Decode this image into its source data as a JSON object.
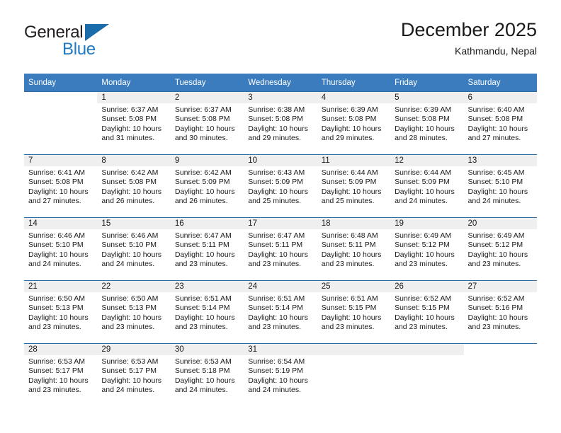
{
  "brand": {
    "name_top": "General",
    "name_bottom": "Blue",
    "color_dark": "#231f20",
    "color_blue": "#1f7ac4",
    "triangle_color": "#1b6cab"
  },
  "header": {
    "title": "December 2025",
    "subtitle": "Kathmandu, Nepal"
  },
  "theme": {
    "header_blue": "#3a7cbe",
    "rule_blue": "#2e6da4",
    "day_band_gray": "#efefef",
    "text": "#1a1a1a"
  },
  "calendar": {
    "weekday_headers": [
      "Sunday",
      "Monday",
      "Tuesday",
      "Wednesday",
      "Thursday",
      "Friday",
      "Saturday"
    ],
    "labels": {
      "sunrise": "Sunrise:",
      "sunset": "Sunset:",
      "daylight": "Daylight:"
    },
    "weeks": [
      [
        {
          "day": "",
          "sunrise": "",
          "sunset": "",
          "daylight": "",
          "band": false
        },
        {
          "day": "1",
          "sunrise": "Sunrise: 6:37 AM",
          "sunset": "Sunset: 5:08 PM",
          "daylight": "Daylight: 10 hours and 31 minutes.",
          "band": true
        },
        {
          "day": "2",
          "sunrise": "Sunrise: 6:37 AM",
          "sunset": "Sunset: 5:08 PM",
          "daylight": "Daylight: 10 hours and 30 minutes.",
          "band": true
        },
        {
          "day": "3",
          "sunrise": "Sunrise: 6:38 AM",
          "sunset": "Sunset: 5:08 PM",
          "daylight": "Daylight: 10 hours and 29 minutes.",
          "band": true
        },
        {
          "day": "4",
          "sunrise": "Sunrise: 6:39 AM",
          "sunset": "Sunset: 5:08 PM",
          "daylight": "Daylight: 10 hours and 29 minutes.",
          "band": true
        },
        {
          "day": "5",
          "sunrise": "Sunrise: 6:39 AM",
          "sunset": "Sunset: 5:08 PM",
          "daylight": "Daylight: 10 hours and 28 minutes.",
          "band": true
        },
        {
          "day": "6",
          "sunrise": "Sunrise: 6:40 AM",
          "sunset": "Sunset: 5:08 PM",
          "daylight": "Daylight: 10 hours and 27 minutes.",
          "band": true
        }
      ],
      [
        {
          "day": "7",
          "sunrise": "Sunrise: 6:41 AM",
          "sunset": "Sunset: 5:08 PM",
          "daylight": "Daylight: 10 hours and 27 minutes.",
          "band": true
        },
        {
          "day": "8",
          "sunrise": "Sunrise: 6:42 AM",
          "sunset": "Sunset: 5:08 PM",
          "daylight": "Daylight: 10 hours and 26 minutes.",
          "band": true
        },
        {
          "day": "9",
          "sunrise": "Sunrise: 6:42 AM",
          "sunset": "Sunset: 5:09 PM",
          "daylight": "Daylight: 10 hours and 26 minutes.",
          "band": true
        },
        {
          "day": "10",
          "sunrise": "Sunrise: 6:43 AM",
          "sunset": "Sunset: 5:09 PM",
          "daylight": "Daylight: 10 hours and 25 minutes.",
          "band": true
        },
        {
          "day": "11",
          "sunrise": "Sunrise: 6:44 AM",
          "sunset": "Sunset: 5:09 PM",
          "daylight": "Daylight: 10 hours and 25 minutes.",
          "band": true
        },
        {
          "day": "12",
          "sunrise": "Sunrise: 6:44 AM",
          "sunset": "Sunset: 5:09 PM",
          "daylight": "Daylight: 10 hours and 24 minutes.",
          "band": true
        },
        {
          "day": "13",
          "sunrise": "Sunrise: 6:45 AM",
          "sunset": "Sunset: 5:10 PM",
          "daylight": "Daylight: 10 hours and 24 minutes.",
          "band": true
        }
      ],
      [
        {
          "day": "14",
          "sunrise": "Sunrise: 6:46 AM",
          "sunset": "Sunset: 5:10 PM",
          "daylight": "Daylight: 10 hours and 24 minutes.",
          "band": true
        },
        {
          "day": "15",
          "sunrise": "Sunrise: 6:46 AM",
          "sunset": "Sunset: 5:10 PM",
          "daylight": "Daylight: 10 hours and 24 minutes.",
          "band": true
        },
        {
          "day": "16",
          "sunrise": "Sunrise: 6:47 AM",
          "sunset": "Sunset: 5:11 PM",
          "daylight": "Daylight: 10 hours and 23 minutes.",
          "band": true
        },
        {
          "day": "17",
          "sunrise": "Sunrise: 6:47 AM",
          "sunset": "Sunset: 5:11 PM",
          "daylight": "Daylight: 10 hours and 23 minutes.",
          "band": true
        },
        {
          "day": "18",
          "sunrise": "Sunrise: 6:48 AM",
          "sunset": "Sunset: 5:11 PM",
          "daylight": "Daylight: 10 hours and 23 minutes.",
          "band": true
        },
        {
          "day": "19",
          "sunrise": "Sunrise: 6:49 AM",
          "sunset": "Sunset: 5:12 PM",
          "daylight": "Daylight: 10 hours and 23 minutes.",
          "band": true
        },
        {
          "day": "20",
          "sunrise": "Sunrise: 6:49 AM",
          "sunset": "Sunset: 5:12 PM",
          "daylight": "Daylight: 10 hours and 23 minutes.",
          "band": true
        }
      ],
      [
        {
          "day": "21",
          "sunrise": "Sunrise: 6:50 AM",
          "sunset": "Sunset: 5:13 PM",
          "daylight": "Daylight: 10 hours and 23 minutes.",
          "band": true
        },
        {
          "day": "22",
          "sunrise": "Sunrise: 6:50 AM",
          "sunset": "Sunset: 5:13 PM",
          "daylight": "Daylight: 10 hours and 23 minutes.",
          "band": true
        },
        {
          "day": "23",
          "sunrise": "Sunrise: 6:51 AM",
          "sunset": "Sunset: 5:14 PM",
          "daylight": "Daylight: 10 hours and 23 minutes.",
          "band": true
        },
        {
          "day": "24",
          "sunrise": "Sunrise: 6:51 AM",
          "sunset": "Sunset: 5:14 PM",
          "daylight": "Daylight: 10 hours and 23 minutes.",
          "band": true
        },
        {
          "day": "25",
          "sunrise": "Sunrise: 6:51 AM",
          "sunset": "Sunset: 5:15 PM",
          "daylight": "Daylight: 10 hours and 23 minutes.",
          "band": true
        },
        {
          "day": "26",
          "sunrise": "Sunrise: 6:52 AM",
          "sunset": "Sunset: 5:15 PM",
          "daylight": "Daylight: 10 hours and 23 minutes.",
          "band": true
        },
        {
          "day": "27",
          "sunrise": "Sunrise: 6:52 AM",
          "sunset": "Sunset: 5:16 PM",
          "daylight": "Daylight: 10 hours and 23 minutes.",
          "band": true
        }
      ],
      [
        {
          "day": "28",
          "sunrise": "Sunrise: 6:53 AM",
          "sunset": "Sunset: 5:17 PM",
          "daylight": "Daylight: 10 hours and 23 minutes.",
          "band": true
        },
        {
          "day": "29",
          "sunrise": "Sunrise: 6:53 AM",
          "sunset": "Sunset: 5:17 PM",
          "daylight": "Daylight: 10 hours and 24 minutes.",
          "band": true
        },
        {
          "day": "30",
          "sunrise": "Sunrise: 6:53 AM",
          "sunset": "Sunset: 5:18 PM",
          "daylight": "Daylight: 10 hours and 24 minutes.",
          "band": true
        },
        {
          "day": "31",
          "sunrise": "Sunrise: 6:54 AM",
          "sunset": "Sunset: 5:19 PM",
          "daylight": "Daylight: 10 hours and 24 minutes.",
          "band": true
        },
        {
          "day": "",
          "sunrise": "",
          "sunset": "",
          "daylight": "",
          "band": true
        },
        {
          "day": "",
          "sunrise": "",
          "sunset": "",
          "daylight": "",
          "band": true
        },
        {
          "day": "",
          "sunrise": "",
          "sunset": "",
          "daylight": "",
          "band": false
        }
      ]
    ]
  }
}
